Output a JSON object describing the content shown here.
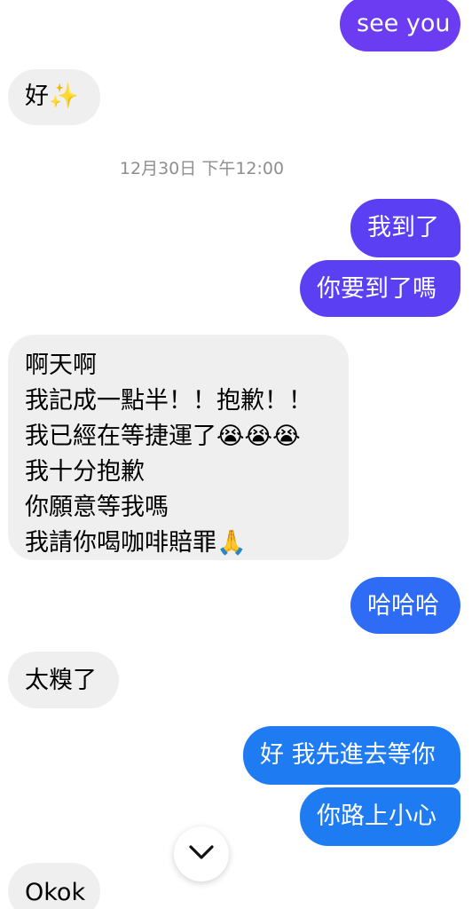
{
  "colors": {
    "incoming_bg": "#efefef",
    "outgoing_purple": "#6b3cf1",
    "outgoing_indigo": "#5a3ff3",
    "outgoing_blue": "#2f6cf5",
    "outgoing_blue2": "#1f7bf2",
    "timestamp_gray": "#8e8e8e"
  },
  "messages": [
    {
      "from": "me",
      "text": "see you"
    },
    {
      "from": "them",
      "text": "好✨"
    },
    {
      "type": "timestamp",
      "text": "12月30日 下午12:00"
    },
    {
      "from": "me",
      "text": "我到了"
    },
    {
      "from": "me",
      "text": "你要到了嗎"
    },
    {
      "from": "them",
      "lines": [
        "啊天啊",
        "我記成一點半！！抱歉！！",
        "我已經在等捷運了😭😭😭",
        "我十分抱歉",
        "你願意等我嗎",
        "我請你喝咖啡賠罪🙏"
      ]
    },
    {
      "from": "me",
      "text": "哈哈哈"
    },
    {
      "from": "them",
      "text": "太糗了"
    },
    {
      "from": "me",
      "text": "好 我先進去等你"
    },
    {
      "from": "me",
      "text": "你路上小心"
    },
    {
      "from": "them",
      "text": "Okok"
    }
  ],
  "scroll_button": {
    "icon": "chevron-down-icon"
  }
}
